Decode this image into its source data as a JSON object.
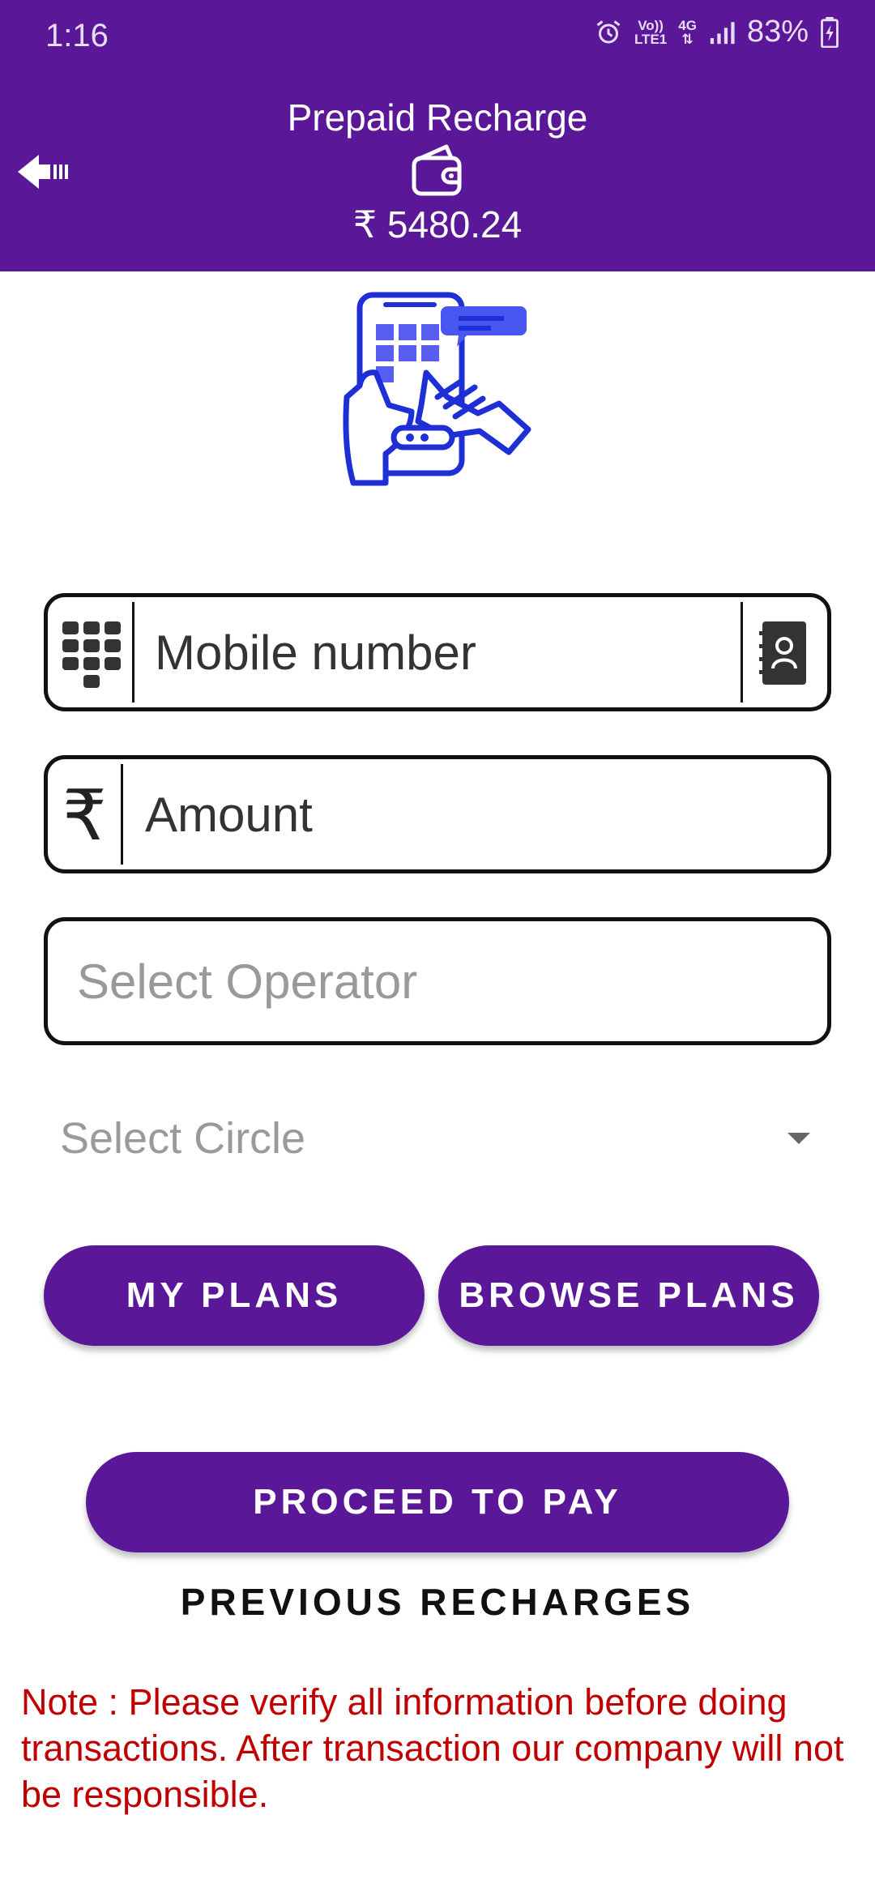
{
  "status_bar": {
    "time": "1:16",
    "network_top": "Vo))",
    "network_bottom": "LTE1",
    "data_type": "4G",
    "battery": "83%"
  },
  "header": {
    "title": "Prepaid Recharge",
    "balance": "₹ 5480.24",
    "background_color": "#5a1899"
  },
  "form": {
    "mobile_placeholder": "Mobile number",
    "amount_placeholder": "Amount",
    "amount_currency_symbol": "₹",
    "operator_placeholder": "Select Operator",
    "circle_placeholder": "Select Circle"
  },
  "buttons": {
    "my_plans": "MY PLANS",
    "browse_plans": "BROWSE PLANS",
    "proceed": "PROCEED TO PAY",
    "previous_recharges": "PREVIOUS RECHARGES"
  },
  "note": "Note : Please verify all information before doing transactions. After transaction our company will not be responsible.",
  "colors": {
    "primary": "#5a1899",
    "note": "#c00000",
    "illustration": "#1f2fd6"
  }
}
